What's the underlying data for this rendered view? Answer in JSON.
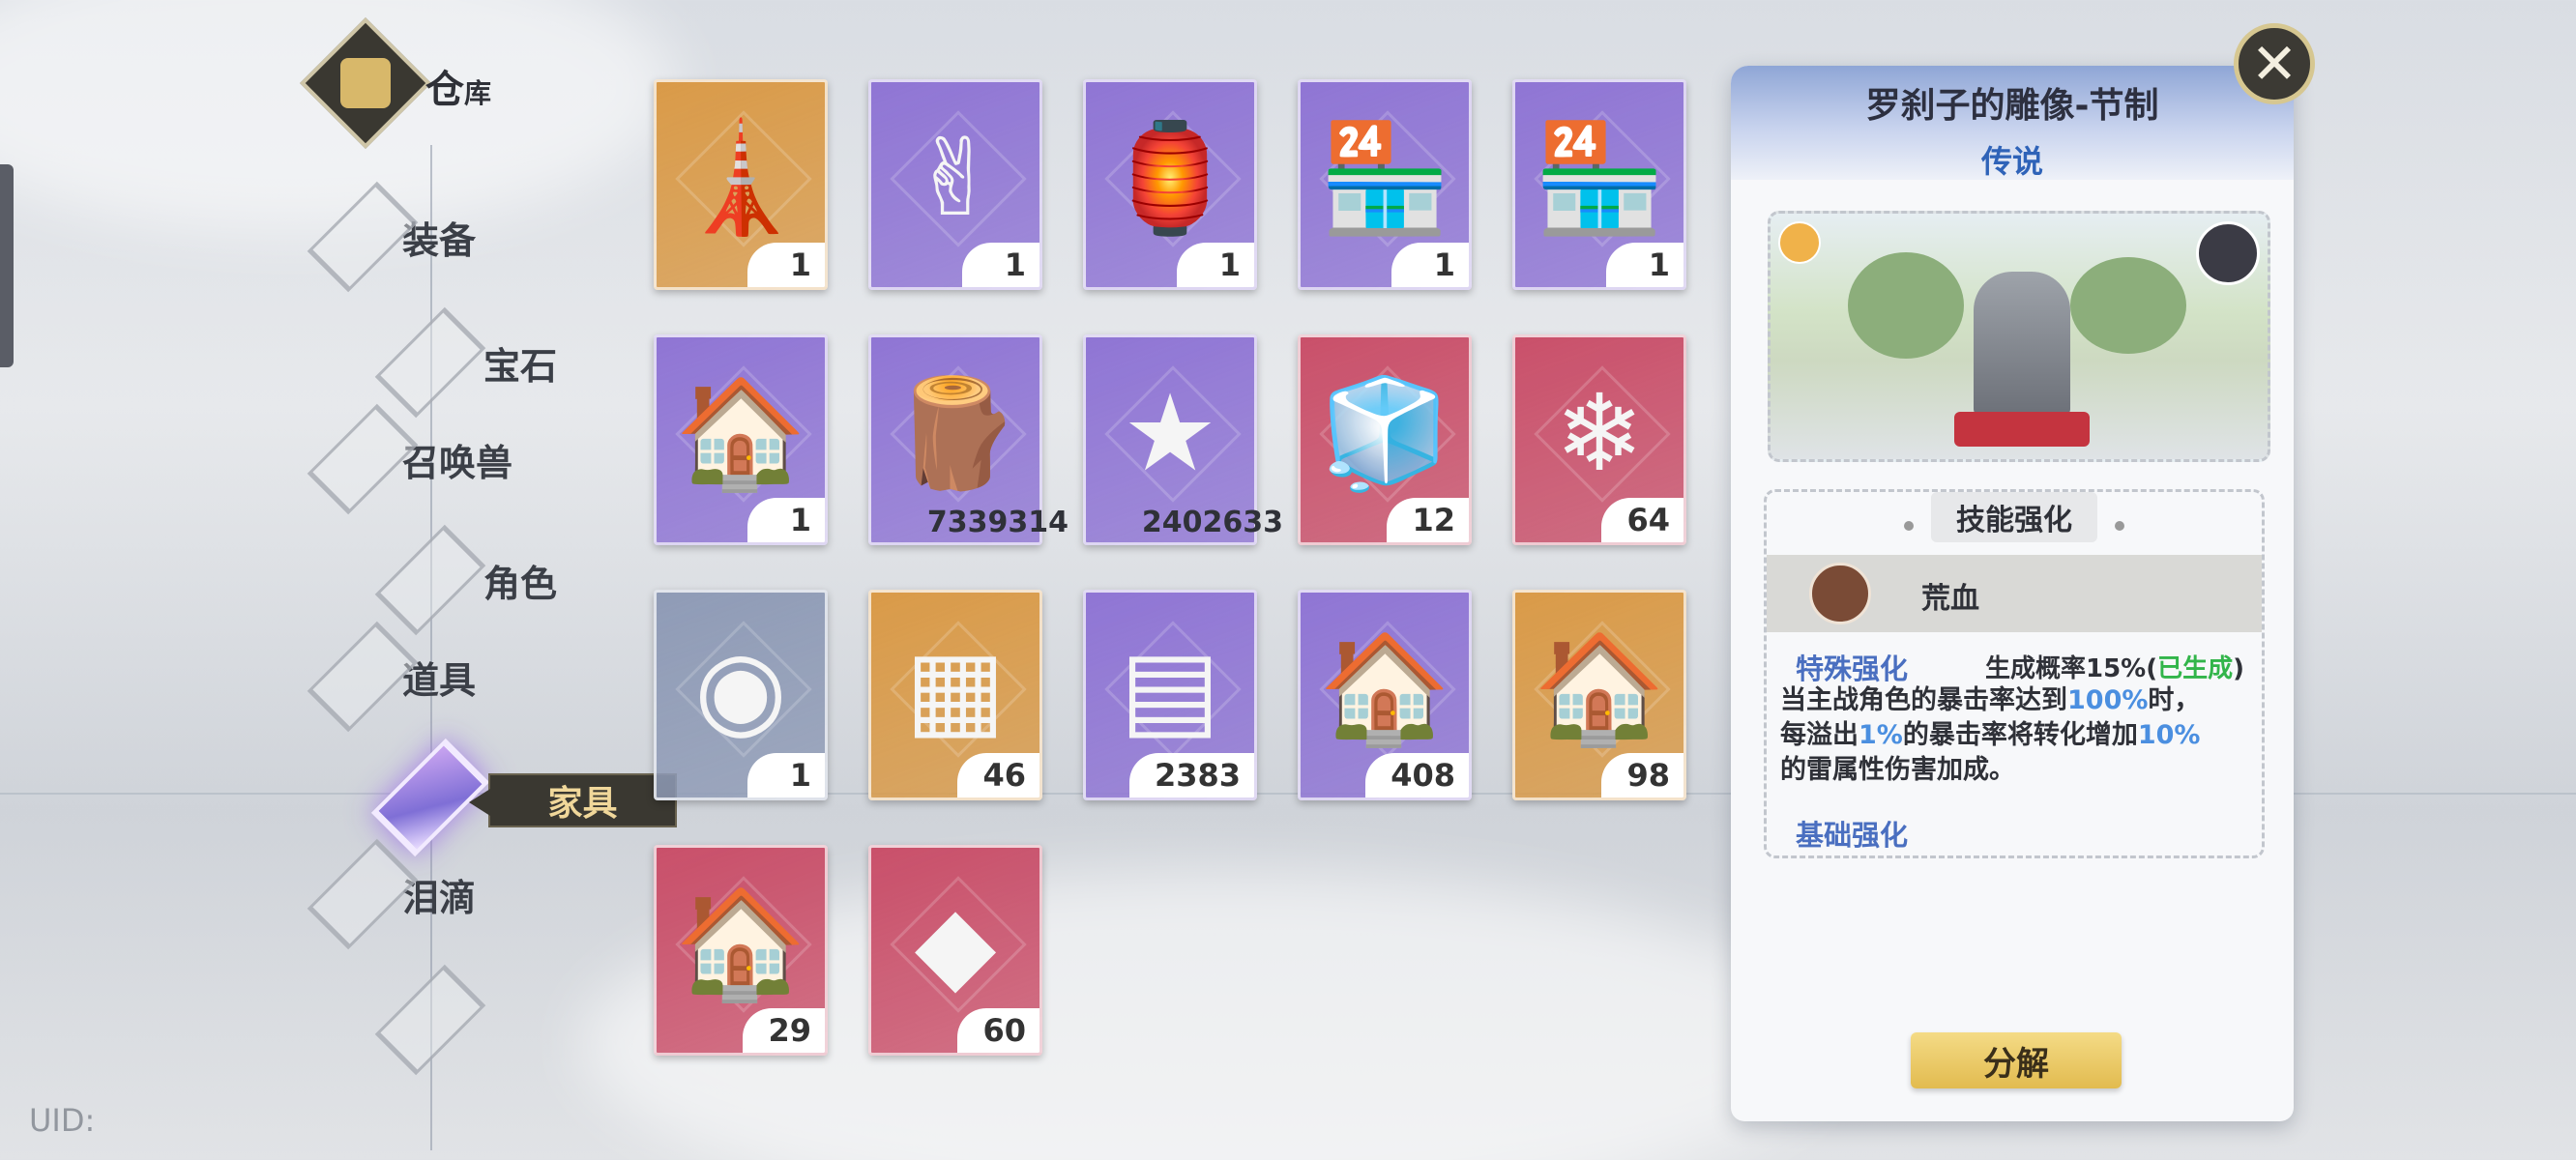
{
  "header": {
    "title_main": "仓",
    "title_sub": "库"
  },
  "nav": {
    "items": [
      {
        "label": "装备"
      },
      {
        "label": "宝石"
      },
      {
        "label": "召唤兽"
      },
      {
        "label": "角色"
      },
      {
        "label": "道具"
      },
      {
        "label": ""
      },
      {
        "label": "泪滴"
      }
    ],
    "active_tooltip": "家具"
  },
  "uid": "UID:",
  "inventory": [
    {
      "icon": "obelisk-icon",
      "color": "#d99a48",
      "count": "1"
    },
    {
      "icon": "peace-hand-icon",
      "color": "#8f75d4",
      "count": "1"
    },
    {
      "icon": "street-lamp-icon",
      "color": "#8f75d4",
      "count": "1"
    },
    {
      "icon": "shop-building-icon",
      "color": "#8f75d4",
      "count": "1"
    },
    {
      "icon": "shop-building-icon",
      "color": "#8f75d4",
      "count": "1"
    },
    {
      "icon": "cottage-icon",
      "color": "#8f75d4",
      "count": "1"
    },
    {
      "icon": "logs-icon",
      "color": "#8f75d4",
      "count": "7339314"
    },
    {
      "icon": "star-icon",
      "color": "#8f75d4",
      "count": "2402633"
    },
    {
      "icon": "ice-chest-icon",
      "color": "#c9506a",
      "count": "12"
    },
    {
      "icon": "ice-rock-icon",
      "color": "#c9506a",
      "count": "64"
    },
    {
      "icon": "portrait-medal-icon",
      "color": "#8f9bb6",
      "count": "1"
    },
    {
      "icon": "ice-bricks-icon",
      "color": "#d99a48",
      "count": "46"
    },
    {
      "icon": "stone-bricks-icon",
      "color": "#8f75d4",
      "count": "2383"
    },
    {
      "icon": "purple-house-icon",
      "color": "#8f75d4",
      "count": "408"
    },
    {
      "icon": "orange-house-icon",
      "color": "#d99a48",
      "count": "98"
    },
    {
      "icon": "red-house-icon",
      "color": "#c9506a",
      "count": "29"
    },
    {
      "icon": "stone-rock-icon",
      "color": "#c9506a",
      "count": "60"
    }
  ],
  "detail": {
    "title": "罗刹子的雕像-节制",
    "rarity": "传说",
    "skill_section": "技能强化",
    "skill_name": "荒血",
    "special_label": "特殊强化",
    "chance_prefix": "生成概率15%(",
    "chance_status": "已生成",
    "chance_suffix": ")",
    "desc_1": "当主战角色的暴击率达到",
    "desc_1_hl": "100%",
    "desc_1_end": "时，",
    "desc_2": "每溢出",
    "desc_2_hl": "1%",
    "desc_2_mid": "的暴击率将转化增加",
    "desc_2_hl2": "10%",
    "desc_3": "的雷属性伤害加成。",
    "base_label": "基础强化",
    "decompose_label": "分解",
    "close_label": "✕"
  }
}
